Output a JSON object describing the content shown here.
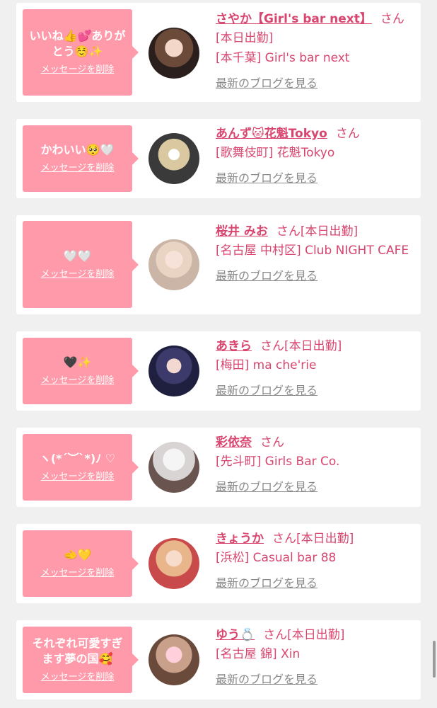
{
  "delete_label": "メッセージを削除",
  "blog_label": "最新のブログを見る",
  "san_label": "さん",
  "accent_color": "#d8456e",
  "bubble_color": "#ff9aaa",
  "items": [
    {
      "message": "いいね👍💕ありがとう☺️✨",
      "name": "さやか【Girl's bar next】",
      "badge": "",
      "shop_lines": [
        "[本日出勤]",
        "[本千葉] Girl's bar next"
      ]
    },
    {
      "message": "かわいい🥺🤍",
      "name": "あんず🐱花魁Tokyo",
      "badge": "",
      "shop_lines": [
        "[歌舞伎町] 花魁Tokyo"
      ]
    },
    {
      "message": "🤍🤍",
      "name": "桜井 みお",
      "badge": "[本日出勤]",
      "shop_lines": [
        "[名古屋 中村区] Club NIGHT CAFE"
      ]
    },
    {
      "message": "🖤✨",
      "name": "あきら",
      "badge": "[本日出勤]",
      "shop_lines": [
        "[梅田] ma che'rie"
      ]
    },
    {
      "message": "ヽ(*´︶`*)ﾉ ♡",
      "name": "彩依奈",
      "badge": "",
      "shop_lines": [
        "[先斗町] Girls Bar Co."
      ]
    },
    {
      "message": "🫲💛",
      "name": "きょうか",
      "badge": "[本日出勤]",
      "shop_lines": [
        "[浜松] Casual bar 88"
      ]
    },
    {
      "message": "それぞれ可愛すぎます夢の国🥰",
      "name": "ゆう💍",
      "badge": "[本日出勤]",
      "shop_lines": [
        "[名古屋 錦] Xin"
      ]
    }
  ]
}
